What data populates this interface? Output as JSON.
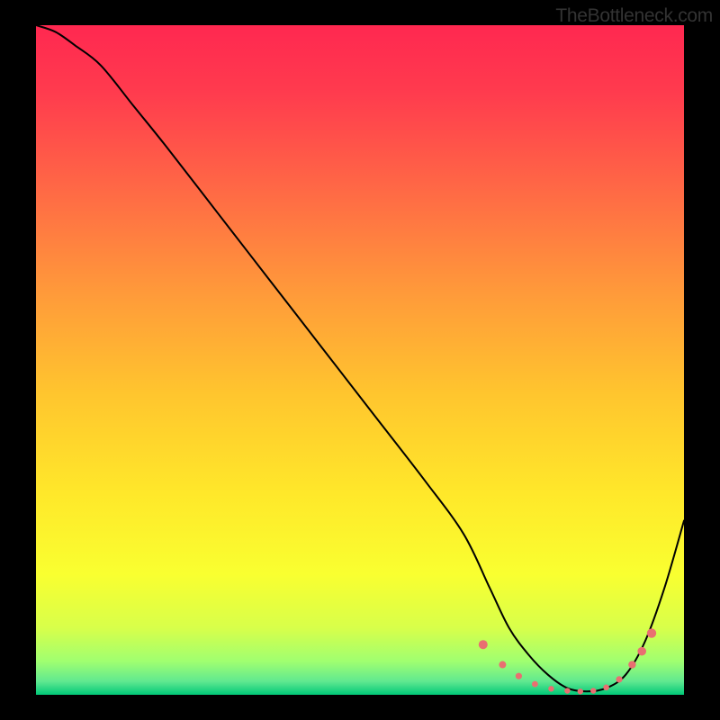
{
  "watermark": "TheBottleneck.com",
  "chart_data": {
    "type": "line",
    "title": "",
    "xlabel": "",
    "ylabel": "",
    "xlim": [
      0,
      100
    ],
    "ylim": [
      0,
      100
    ],
    "background_gradient": {
      "stops": [
        {
          "offset": 0.0,
          "color": "#ff2850"
        },
        {
          "offset": 0.1,
          "color": "#ff3b4e"
        },
        {
          "offset": 0.25,
          "color": "#ff6a45"
        },
        {
          "offset": 0.4,
          "color": "#ff9a3a"
        },
        {
          "offset": 0.55,
          "color": "#ffc52e"
        },
        {
          "offset": 0.7,
          "color": "#ffe82a"
        },
        {
          "offset": 0.82,
          "color": "#f9ff30"
        },
        {
          "offset": 0.9,
          "color": "#d8ff4a"
        },
        {
          "offset": 0.95,
          "color": "#a0ff70"
        },
        {
          "offset": 0.98,
          "color": "#60e890"
        },
        {
          "offset": 1.0,
          "color": "#00c878"
        }
      ]
    },
    "series": [
      {
        "name": "bottleneck-curve",
        "color": "#000000",
        "x": [
          0,
          3,
          6,
          10,
          15,
          20,
          28,
          36,
          44,
          52,
          60,
          66,
          70,
          73,
          76,
          79,
          82,
          85,
          88,
          91,
          94,
          97,
          100
        ],
        "values": [
          100,
          99,
          97,
          94,
          88,
          82,
          72,
          62,
          52,
          42,
          32,
          24,
          16,
          10,
          6,
          3,
          1,
          0.5,
          1,
          3,
          8,
          16,
          26
        ]
      }
    ],
    "markers": {
      "name": "highlight-points",
      "color": "#e96f71",
      "x": [
        69,
        72,
        74.5,
        77,
        79.5,
        82,
        84,
        86,
        88,
        90,
        92,
        93.5,
        95
      ],
      "values": [
        7.5,
        4.5,
        2.8,
        1.6,
        0.9,
        0.6,
        0.5,
        0.6,
        1.1,
        2.3,
        4.5,
        6.5,
        9.2
      ],
      "sizes": [
        5,
        4,
        3.6,
        3.4,
        3.2,
        3.2,
        3.2,
        3.2,
        3.3,
        3.6,
        4.2,
        4.8,
        5.2
      ]
    }
  }
}
